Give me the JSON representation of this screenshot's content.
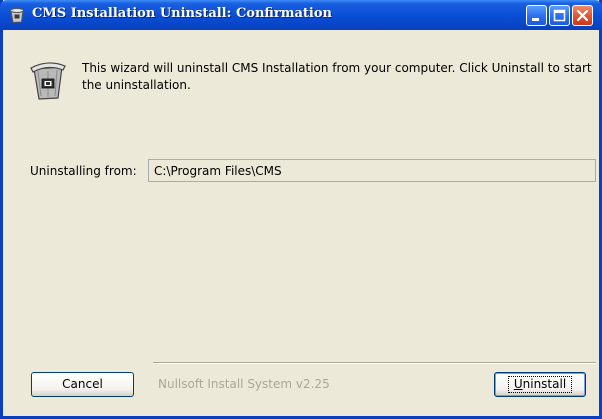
{
  "window": {
    "title": "CMS Installation Uninstall: Confirmation",
    "titlebar_color": "#0a4fd6",
    "controls": [
      "minimize-icon",
      "maximize-icon",
      "close-icon"
    ]
  },
  "content": {
    "icon": "trash-can-icon",
    "intro_text": "This wizard will uninstall CMS Installation from your computer. Click Uninstall to start the uninstallation.",
    "path_label": "Uninstalling from:",
    "path_value": "C:\\Program Files\\CMS"
  },
  "footer": {
    "cancel_label": "Cancel",
    "branding": "Nullsoft Install System v2.25",
    "uninstall_label_mnemonic": "U",
    "uninstall_label_rest": "ninstall"
  }
}
